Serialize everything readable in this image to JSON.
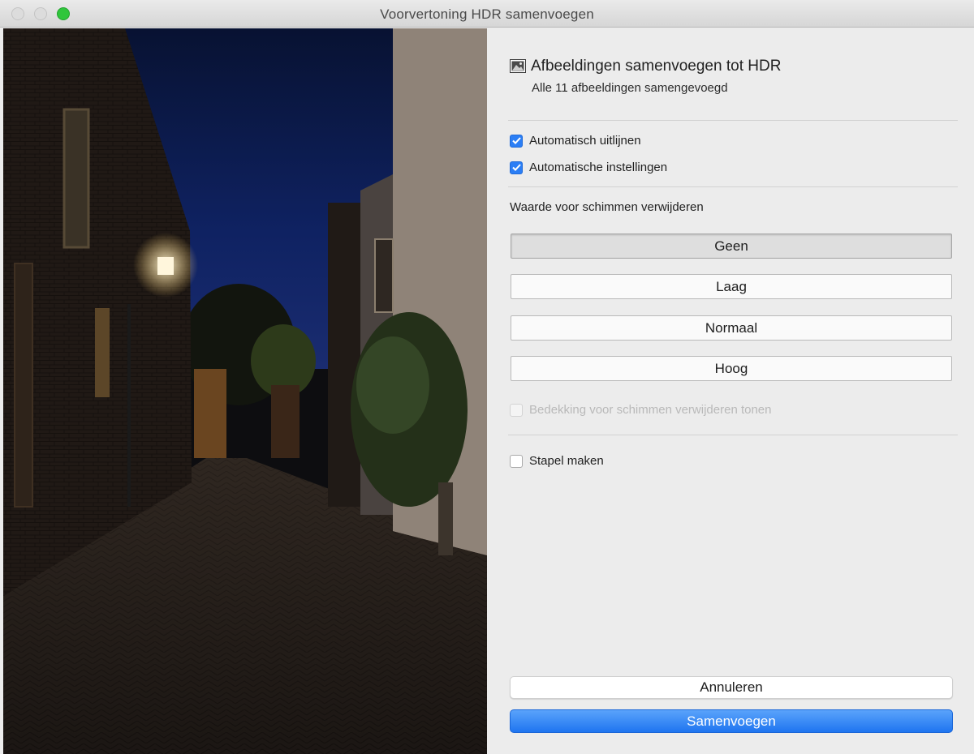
{
  "window": {
    "title": "Voorvertoning HDR samenvoegen"
  },
  "header": {
    "title": "Afbeeldingen samenvoegen tot HDR",
    "subtitle": "Alle 11 afbeeldingen samengevoegd",
    "icon": "image-icon"
  },
  "options": {
    "auto_align": {
      "label": "Automatisch uitlijnen",
      "checked": true
    },
    "auto_settings": {
      "label": "Automatische instellingen",
      "checked": true
    }
  },
  "deghost": {
    "label": "Waarde voor schimmen verwijderen",
    "levels": [
      "Geen",
      "Laag",
      "Normaal",
      "Hoog"
    ],
    "selected": "Geen",
    "overlay": {
      "label": "Bedekking voor schimmen verwijderen tonen",
      "checked": false,
      "enabled": false
    }
  },
  "stack": {
    "label": "Stapel maken",
    "checked": false
  },
  "actions": {
    "cancel": "Annuleren",
    "merge": "Samenvoegen"
  },
  "colors": {
    "accent": "#2b7ef5",
    "merge_button": "#1f75f0",
    "sky": "#0e1f5c"
  }
}
